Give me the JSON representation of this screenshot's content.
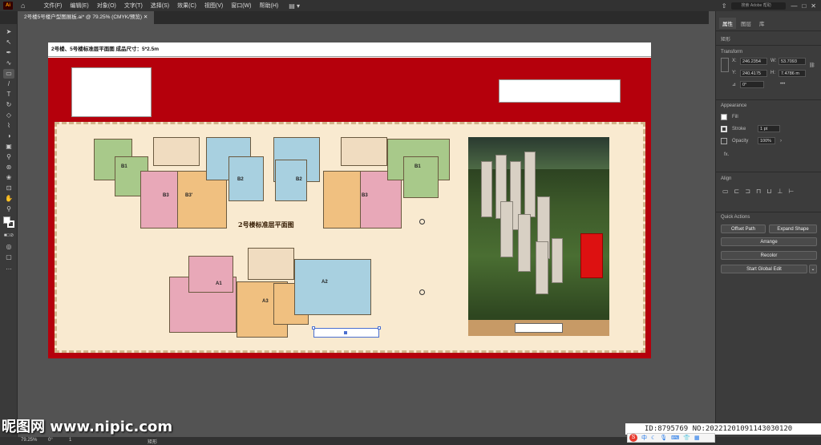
{
  "app": {
    "logo": "Ai",
    "menus": [
      "文件(F)",
      "编辑(E)",
      "对象(O)",
      "文字(T)",
      "选择(S)",
      "效果(C)",
      "视图(V)",
      "窗口(W)",
      "帮助(H)"
    ],
    "search_placeholder": "搜索 Adobe 帮助"
  },
  "document": {
    "tab_title": "2号楼5号楼户型图展板.ai* @ 79.25% (CMYK/预览)",
    "artboard_header": "2号楼、5号楼标准层平面图   成品尺寸：5*2.5m"
  },
  "artwork": {
    "plan_title": "2号楼标准层平面图",
    "unit_labels": [
      "B1",
      "B2",
      "B2",
      "B3",
      "B3'",
      "B3",
      "B1",
      "A1",
      "A3",
      "A2"
    ]
  },
  "right_panel": {
    "tabs": [
      "属性",
      "图层",
      "库"
    ],
    "object_type": "矩形",
    "transform_label": "Transform",
    "x_label": "X:",
    "x": "246.2354",
    "y_label": "Y:",
    "y": "240.4175",
    "w_label": "W:",
    "w": "53.7093",
    "h_label": "H:",
    "h": "7.4786 m",
    "rotate": "0°",
    "appearance_label": "Appearance",
    "fill_label": "Fill",
    "stroke_label": "Stroke",
    "stroke_value": "1 pt",
    "opacity_label": "Opacity",
    "opacity_value": "100%",
    "fx_label": "fx.",
    "align_label": "Align",
    "quick_actions_label": "Quick Actions",
    "offset_path": "Offset Path",
    "expand_shape": "Expand Shape",
    "arrange": "Arrange",
    "recolor": "Recolor",
    "start_global_edit": "Start Global Edit"
  },
  "status": {
    "zoom": "79.25%",
    "angle": "0°",
    "artboard_num": "1",
    "tool_name": "矩形"
  },
  "watermark": {
    "site": "昵图网 www.nipic.com",
    "id_text": "ID:8795769 NO:20221201091143030120"
  },
  "ime": {
    "lang": "中"
  }
}
